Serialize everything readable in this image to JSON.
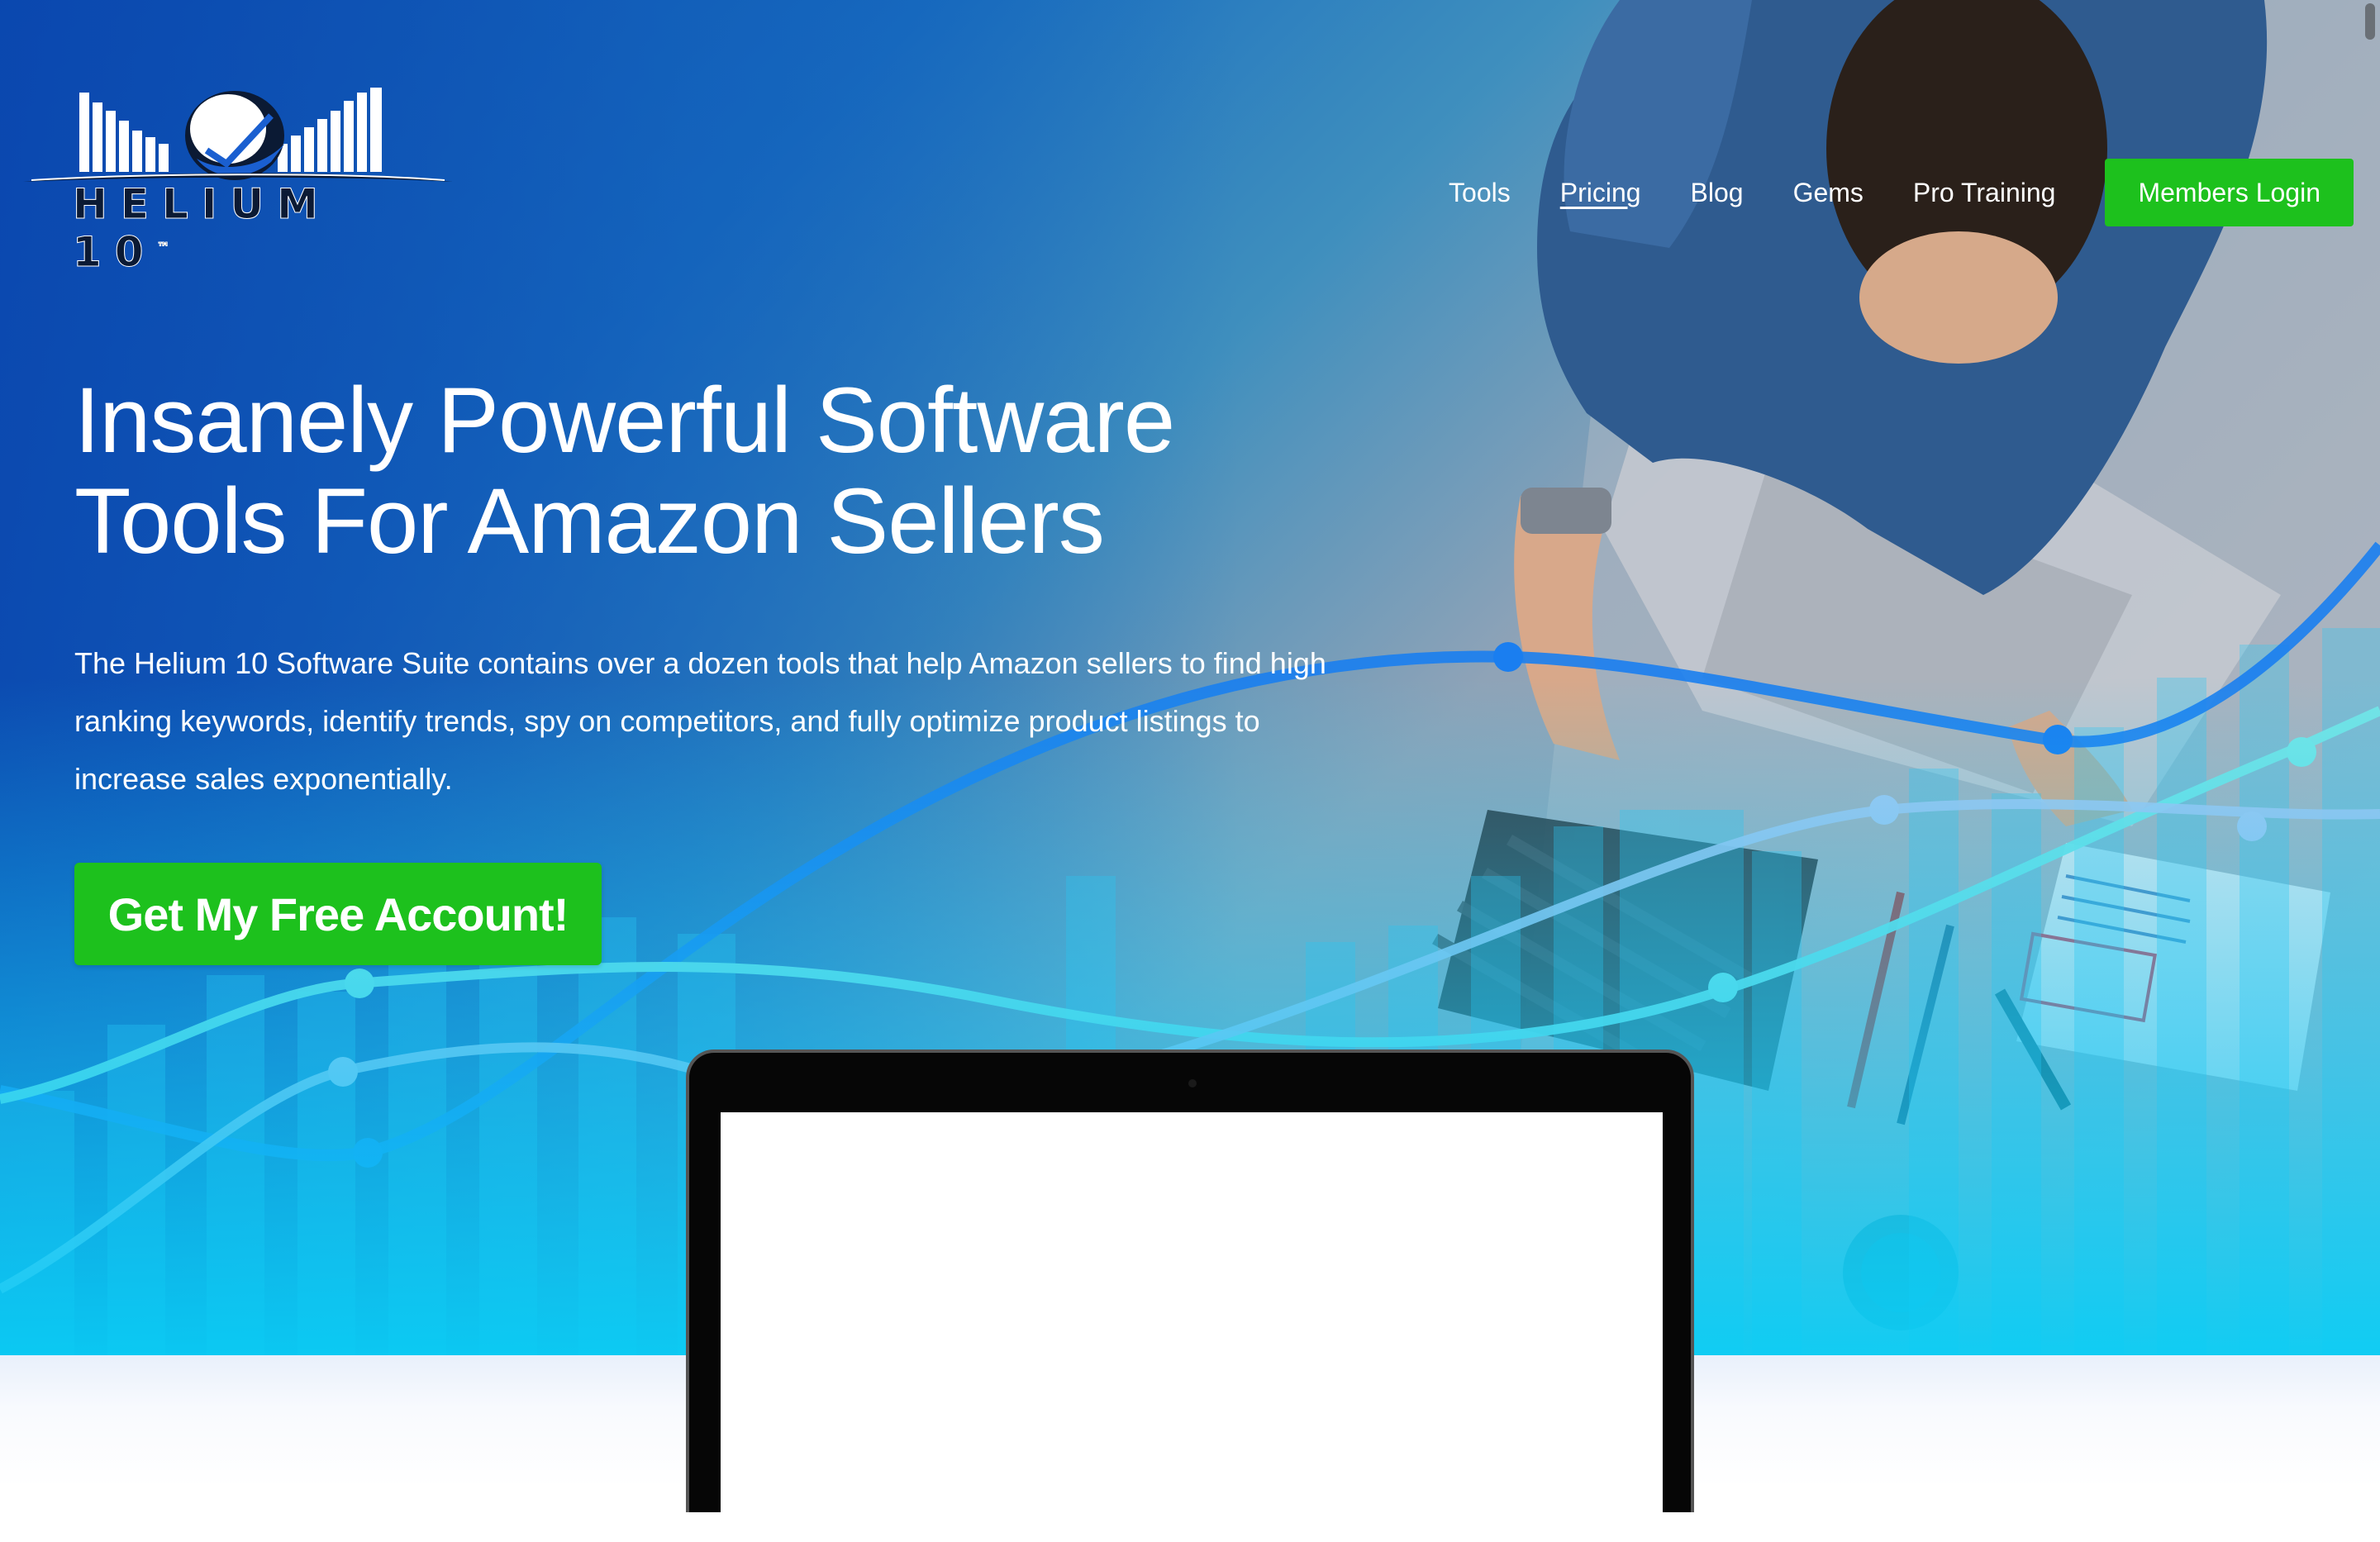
{
  "brand": {
    "name": "HELIUM 10",
    "trademark": "™",
    "colors": {
      "accent_green": "#1dc11d",
      "hero_blue": "#0d4fae",
      "hero_cyan": "#0acdf5"
    }
  },
  "nav": {
    "items": [
      {
        "label": "Tools"
      },
      {
        "label": "Pricing"
      },
      {
        "label": "Blog"
      },
      {
        "label": "Gems"
      },
      {
        "label": "Pro Training"
      }
    ],
    "members_login": "Members Login"
  },
  "hero": {
    "headline_line1": "Insanely Powerful Software",
    "headline_line2": "Tools For Amazon Sellers",
    "description": "The Helium 10 Software Suite contains over a dozen tools that help Amazon sellers to find high ranking keywords, identify trends, spy on competitors, and fully optimize product listings to increase sales exponentially.",
    "cta_label": "Get My Free Account!"
  },
  "icons": {
    "logo": "helium10-logo-icon",
    "laptop": "laptop-frame"
  }
}
